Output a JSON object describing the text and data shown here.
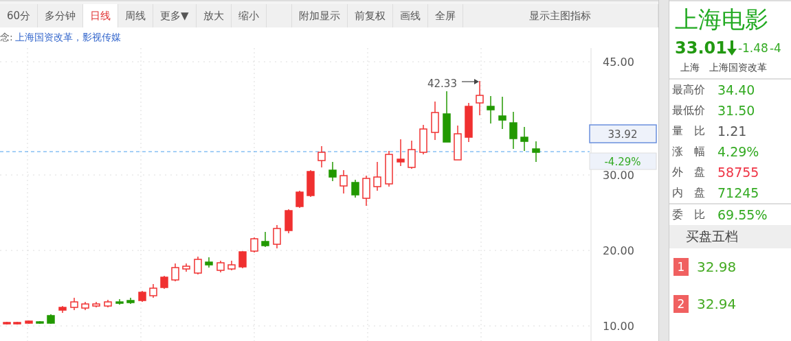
{
  "toolbar": [
    {
      "label": "60分",
      "selected": false
    },
    {
      "label": "多分钟",
      "selected": false
    },
    {
      "label": "日线",
      "selected": true
    },
    {
      "label": "周线",
      "selected": false
    },
    {
      "label": "更多▼",
      "selected": false
    },
    {
      "label": "放大",
      "selected": false
    },
    {
      "label": "缩小",
      "selected": false
    },
    {
      "kind": "blank",
      "selected": false
    },
    {
      "label": "附加显示",
      "selected": false
    },
    {
      "label": "前复权",
      "selected": false
    },
    {
      "label": "画线",
      "selected": false
    },
    {
      "label": "全屏",
      "selected": false
    },
    {
      "label": "显示主图指标",
      "selected": false
    }
  ],
  "concept": {
    "prefix": "念:",
    "text": "上海国资改革，影视传媒"
  },
  "chart": {
    "axis_labels": [
      "45.00",
      "30.00",
      "20.00",
      "10.00"
    ],
    "high_label": "42.33",
    "price_box": "33.92",
    "change_box": "-4.29%"
  },
  "quote": {
    "name": "上海电影",
    "price": "33.01",
    "change": "-1.48",
    "change_pct": "-4",
    "market": "上海",
    "sector": "上海国资改革"
  },
  "stats": [
    {
      "label": "最高价",
      "value": "34.40",
      "color": "#33aa22"
    },
    {
      "label": "最低价",
      "value": "31.50",
      "color": "#33aa22"
    },
    {
      "label": "量　比",
      "value": "1.21",
      "color": "#555555"
    },
    {
      "label": "涨　幅",
      "value": "4.29%",
      "color": "#33aa22"
    },
    {
      "label": "外　盘",
      "value": "58755",
      "color": "#ee3344"
    },
    {
      "label": "内　盘",
      "value": "71245",
      "color": "#33aa22"
    }
  ],
  "ratio": {
    "label": "委　比",
    "value": "69.55%"
  },
  "bids": {
    "title": "买盘五档",
    "rows": [
      {
        "index": "1",
        "price": "32.98"
      },
      {
        "index": "2",
        "price": "32.94"
      }
    ]
  }
}
